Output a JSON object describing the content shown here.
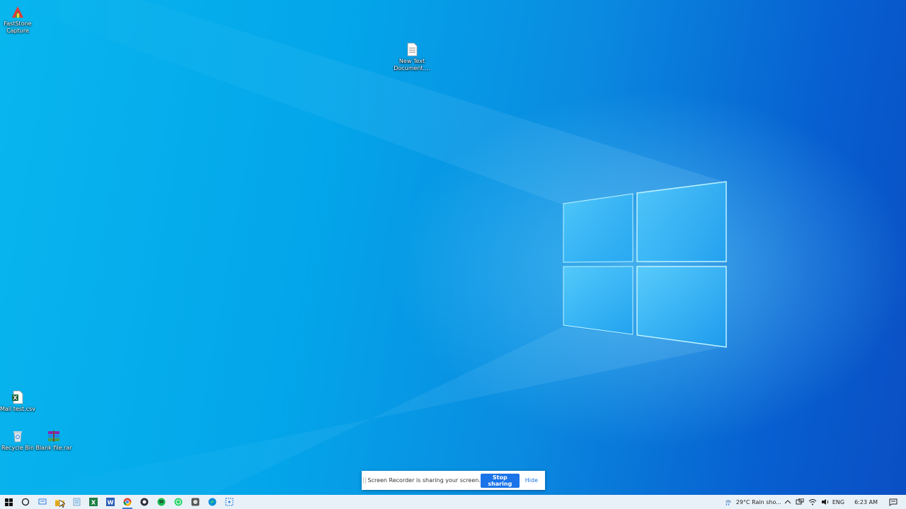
{
  "desktop": {
    "icons": [
      {
        "label_line1": "FastStone",
        "label_line2": "Capture",
        "icon": "faststone-capture-icon"
      },
      {
        "label_line1": "New Text",
        "label_line2": "Document....",
        "icon": "text-document-icon"
      },
      {
        "label_line1": "Mail test.csv",
        "label_line2": "",
        "icon": "excel-csv-icon"
      },
      {
        "label_line1": "Recycle Bin",
        "label_line2": "",
        "icon": "recycle-bin-icon"
      },
      {
        "label_line1": "Blank file.rar",
        "label_line2": "",
        "icon": "winrar-archive-icon"
      }
    ]
  },
  "sharing_banner": {
    "grip": "||",
    "message": "Screen Recorder is sharing your screen.",
    "stop_label": "Stop sharing",
    "hide_label": "Hide"
  },
  "taskbar": {
    "apps": [
      "start-icon",
      "search-icon",
      "task-view-icon",
      "file-explorer-icon",
      "notepad-icon",
      "excel-icon",
      "word-icon",
      "chrome-icon",
      "obs-icon",
      "spotify-icon",
      "whatsapp-icon",
      "app-icon",
      "edge-icon",
      "snipping-tool-icon"
    ],
    "weather": "29°C  Rain sho...",
    "language": "ENG",
    "time": "6:23 AM"
  },
  "colors": {
    "accent": "#1a73e8",
    "taskbar": "#e9f1f8"
  }
}
